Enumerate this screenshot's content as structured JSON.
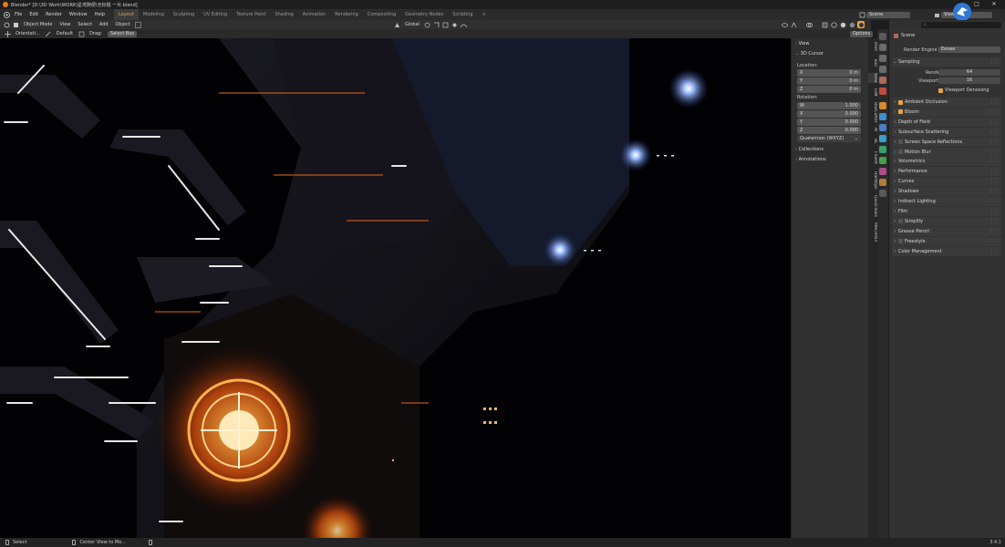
{
  "title": "Blender* [D:\\3D Work\\WORK\\星鸢随便\\无标题 一片.blend]",
  "window_controls": [
    "—",
    "□",
    "✕"
  ],
  "menus": [
    "File",
    "Edit",
    "Render",
    "Window",
    "Help"
  ],
  "workspaces": [
    "Layout",
    "Modeling",
    "Sculpting",
    "UV Editing",
    "Texture Paint",
    "Shading",
    "Animation",
    "Rendering",
    "Compositing",
    "Geometry Nodes",
    "Scripting"
  ],
  "active_workspace": "Layout",
  "add_workspace": "+",
  "scene_field": "Scene",
  "viewlayer_field": "ViewLayer",
  "header": {
    "mode": "Object Mode",
    "menus": [
      "View",
      "Select",
      "Add",
      "Object"
    ],
    "transform": "Global",
    "options": "Options"
  },
  "toolsettings": {
    "orientation_label": "Orientati...",
    "orientation_value": "Default",
    "drag_label": "Drag:",
    "drag_value": "Select Box"
  },
  "npanel": {
    "view": "View",
    "cursor": "3D Cursor",
    "location_label": "Location:",
    "location": [
      {
        "axis": "X",
        "value": "0 m"
      },
      {
        "axis": "Y",
        "value": "0 m"
      },
      {
        "axis": "Z",
        "value": "0 m"
      }
    ],
    "rotation_label": "Rotation:",
    "rotation": [
      {
        "axis": "W",
        "value": "1.000"
      },
      {
        "axis": "X",
        "value": "0.000"
      },
      {
        "axis": "Y",
        "value": "0.000"
      },
      {
        "axis": "Z",
        "value": "0.000"
      }
    ],
    "rotation_mode": "Quaternion (WXYZ)",
    "collections": "Collections",
    "annotations": "Annotations"
  },
  "ntabs": [
    "Item",
    "Tool",
    "View",
    "Edit",
    "BoxCutter",
    "AI",
    "BL",
    "Fluent",
    "HardOps",
    "QuickTools",
    "MACHIN3"
  ],
  "properties": {
    "scene": "Scene",
    "render_engine_label": "Render Engine",
    "render_engine": "Eevee",
    "sampling": "Sampling",
    "render_label": "Render",
    "render_value": "64",
    "viewport_label": "Viewport",
    "viewport_value": "16",
    "viewport_denoising": "Viewport Denoising",
    "sections": [
      {
        "label": "Ambient Occlusion",
        "checkbox": "on"
      },
      {
        "label": "Bloom",
        "checkbox": "on"
      },
      {
        "label": "Depth of Field",
        "checkbox": "none"
      },
      {
        "label": "Subsurface Scattering",
        "checkbox": "none"
      },
      {
        "label": "Screen Space Reflections",
        "checkbox": "off"
      },
      {
        "label": "Motion Blur",
        "checkbox": "off"
      },
      {
        "label": "Volumetrics",
        "checkbox": "none"
      },
      {
        "label": "Performance",
        "checkbox": "none"
      },
      {
        "label": "Curves",
        "checkbox": "none"
      },
      {
        "label": "Shadows",
        "checkbox": "none"
      },
      {
        "label": "Indirect Lighting",
        "checkbox": "none"
      },
      {
        "label": "Film",
        "checkbox": "none"
      },
      {
        "label": "Simplify",
        "checkbox": "off"
      },
      {
        "label": "Grease Pencil",
        "checkbox": "none"
      },
      {
        "label": "Freestyle",
        "checkbox": "off"
      },
      {
        "label": "Color Management",
        "checkbox": "none"
      }
    ]
  },
  "status": {
    "select": "Select",
    "center": "Center View to Mo...",
    "version": "3.4.1"
  },
  "colors": {
    "accent": "#e8a448",
    "checkbox": "#4772b3",
    "orange_glow": "#ff7a1a",
    "blue_glow": "#8fb4ff"
  }
}
